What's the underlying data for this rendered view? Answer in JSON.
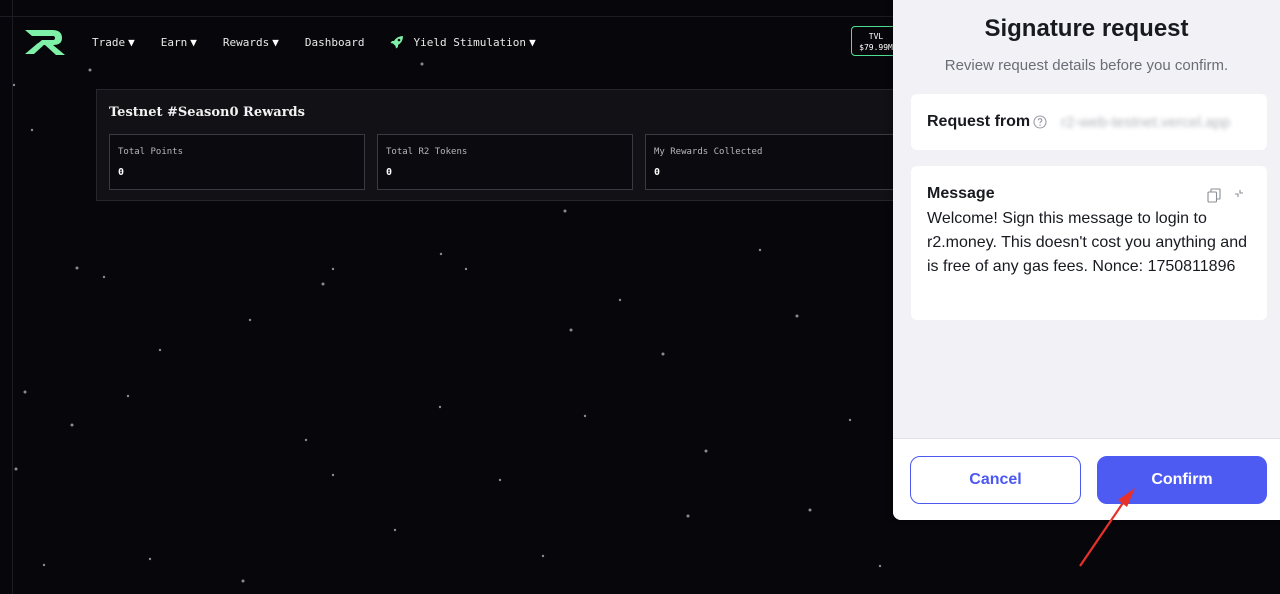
{
  "nav": {
    "items": [
      {
        "label": "Trade",
        "caret": "▼"
      },
      {
        "label": "Earn",
        "caret": "▼"
      },
      {
        "label": "Rewards",
        "caret": "▼"
      },
      {
        "label": "Dashboard"
      },
      {
        "label": "Yield Stimulation",
        "caret": "▼",
        "icon": "rocket-icon"
      }
    ],
    "tvl_label": "TVL",
    "tvl_value": "$79.99M"
  },
  "rewards": {
    "title": "Testnet #Season0 Rewards",
    "stats": [
      {
        "label": "Total Points",
        "value": "0"
      },
      {
        "label": "Total R2 Tokens",
        "value": "0"
      },
      {
        "label": "My Rewards Collected",
        "value": "0"
      }
    ]
  },
  "signature": {
    "title": "Signature request",
    "subtitle": "Review request details before you confirm.",
    "request_from_label": "Request from",
    "request_from_value": "r2-web-testnet.vercel.app",
    "message_label": "Message",
    "message_text": "Welcome! Sign this message to login to r2.money. This doesn't cost you anything and is free of any gas fees. Nonce: 1750811896",
    "cancel_label": "Cancel",
    "confirm_label": "Confirm"
  },
  "colors": {
    "accent": "#4e5bf3",
    "brand_green": "#7ef0a8",
    "annotation_arrow": "#e8302a"
  }
}
